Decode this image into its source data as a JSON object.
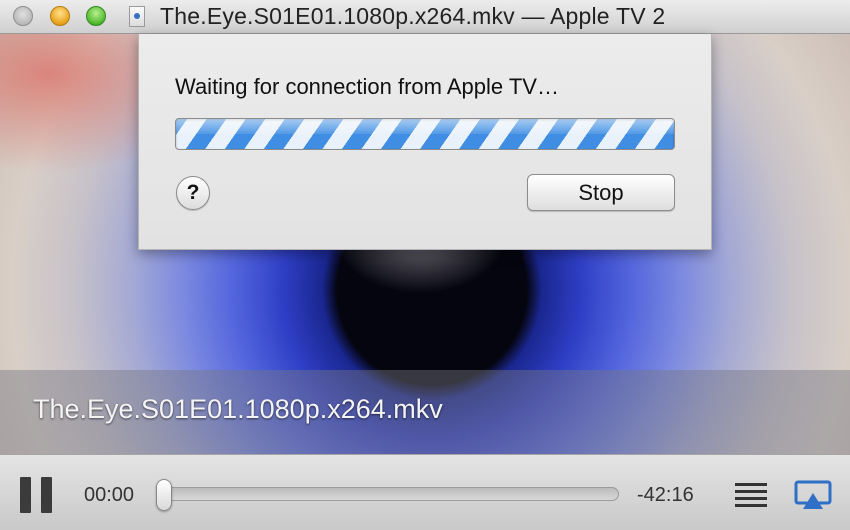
{
  "window": {
    "title": "The.Eye.S01E01.1080p.x264.mkv — Apple TV 2"
  },
  "video": {
    "filename": "The.Eye.S01E01.1080p.x264.mkv"
  },
  "sheet": {
    "message": "Waiting for connection from Apple TV…",
    "help_label": "?",
    "stop_label": "Stop",
    "progress": "indeterminate"
  },
  "controls": {
    "elapsed": "00:00",
    "remaining": "-42:16",
    "position_fraction": 0
  },
  "icons": [
    "close-icon",
    "minimize-icon",
    "maximize-icon",
    "document-icon",
    "pause-icon",
    "playlist-icon",
    "airplay-icon"
  ],
  "colors": {
    "progress_stripe": "#3f8ee3",
    "airplay_accent": "#2f6fc6"
  }
}
